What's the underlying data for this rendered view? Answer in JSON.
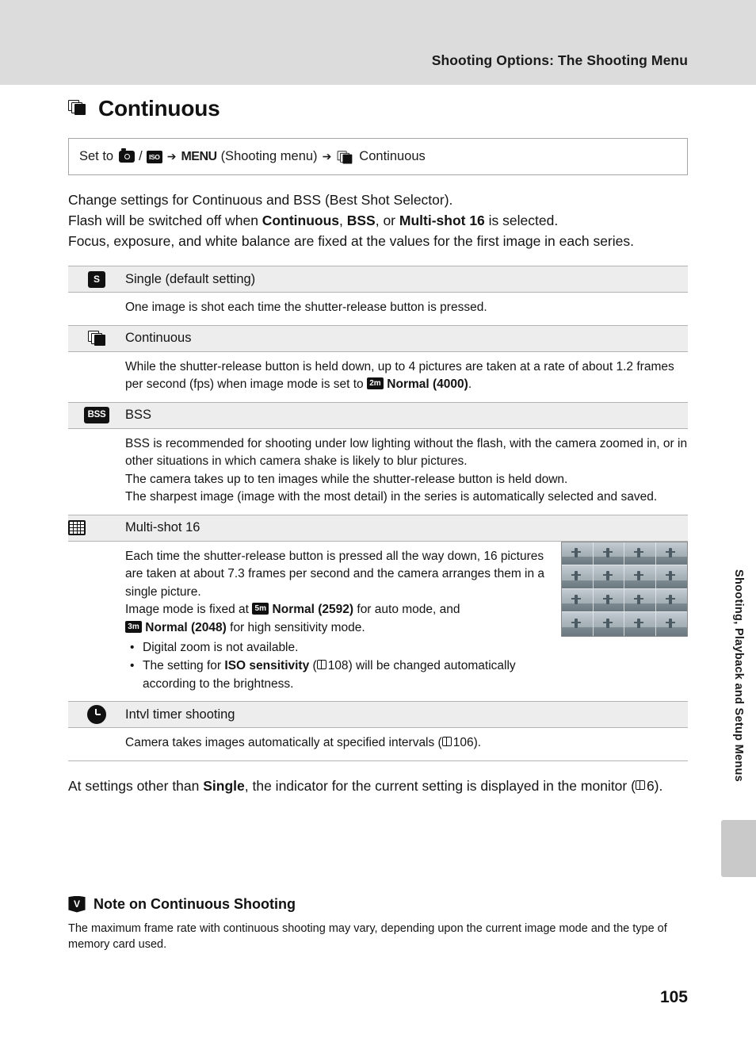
{
  "header": {
    "title": "Shooting Options: The Shooting Menu"
  },
  "title": {
    "icon": "continuous-frames-icon",
    "text": "Continuous"
  },
  "setto": {
    "prefix": "Set to",
    "icon1": "camera-auto-mode-icon",
    "separator": "/",
    "icon2": "high-sensitivity-mode-icon",
    "arrow1": "➔",
    "menu_word": "MENU",
    "menu_paren": "(Shooting menu)",
    "arrow2": "➔",
    "icon3": "continuous-frames-icon",
    "target": "Continuous"
  },
  "intro": {
    "line1": "Change settings for Continuous and BSS (Best Shot Selector).",
    "line2_a": "Flash will be switched off when ",
    "line2_b1": "Continuous",
    "line2_c": ", ",
    "line2_b2": "BSS",
    "line2_d": ", or ",
    "line2_b3": "Multi-shot 16",
    "line2_e": " is selected.",
    "line3": "Focus, exposure, and white balance are fixed at the values for the first image in each series."
  },
  "options": [
    {
      "icon": "single-shot-icon",
      "label": "Single (default setting)",
      "body": "One image is shot each time the shutter-release button is pressed."
    },
    {
      "icon": "continuous-frames-icon",
      "label": "Continuous",
      "body_a": "While the shutter-release button is held down, up to 4 pictures are taken at a rate of about 1.2 frames per second (fps) when image mode is set to ",
      "badge": "2m",
      "body_b": " Normal (4000)",
      "body_c": "."
    },
    {
      "icon": "bss-icon",
      "label": "BSS",
      "body_line1": "BSS is recommended for shooting under low lighting without the flash, with the camera zoomed in, or in other situations in which camera shake is likely to blur pictures.",
      "body_line2": "The camera takes up to ten images while the shutter-release button is held down.",
      "body_line3": "The sharpest image (image with the most detail) in the series is automatically selected and saved."
    },
    {
      "icon": "multishot-16-icon",
      "label": "Multi-shot 16",
      "body_line1": "Each time the shutter-release button is pressed all the way down, 16 pictures are taken at about 7.3 frames per second and the camera arranges them in a single picture.",
      "body_line2_a": "Image mode is fixed at ",
      "badge1": "5m",
      "body_line2_b": " Normal (2592)",
      "body_line2_c": " for auto mode, and ",
      "badge2": "3m",
      "body_line2_d": " Normal (2048)",
      "body_line2_e": " for high sensitivity mode.",
      "bullet1": "Digital zoom is not available.",
      "bullet2_a": "The setting for ",
      "bullet2_b": "ISO sensitivity",
      "bullet2_c": " (",
      "bullet2_ref": "108",
      "bullet2_d": ") will be changed automatically according to the brightness.",
      "image_name": "multi-shot-16-sample-image"
    },
    {
      "icon": "interval-timer-icon",
      "label": "Intvl timer shooting",
      "body_a": "Camera takes images automatically at specified intervals (",
      "body_ref": "106",
      "body_b": ")."
    }
  ],
  "closing": {
    "a": "At settings other than ",
    "b": "Single",
    "c": ", the indicator for the current setting is displayed in the monitor (",
    "ref": "6",
    "d": ")."
  },
  "note": {
    "icon": "caution-icon",
    "title": "Note on Continuous Shooting",
    "body": "The maximum frame rate with continuous shooting may vary, depending upon the current image mode and the type of memory card used."
  },
  "side_tab": {
    "text": "Shooting, Playback and Setup Menus"
  },
  "page_number": "105"
}
